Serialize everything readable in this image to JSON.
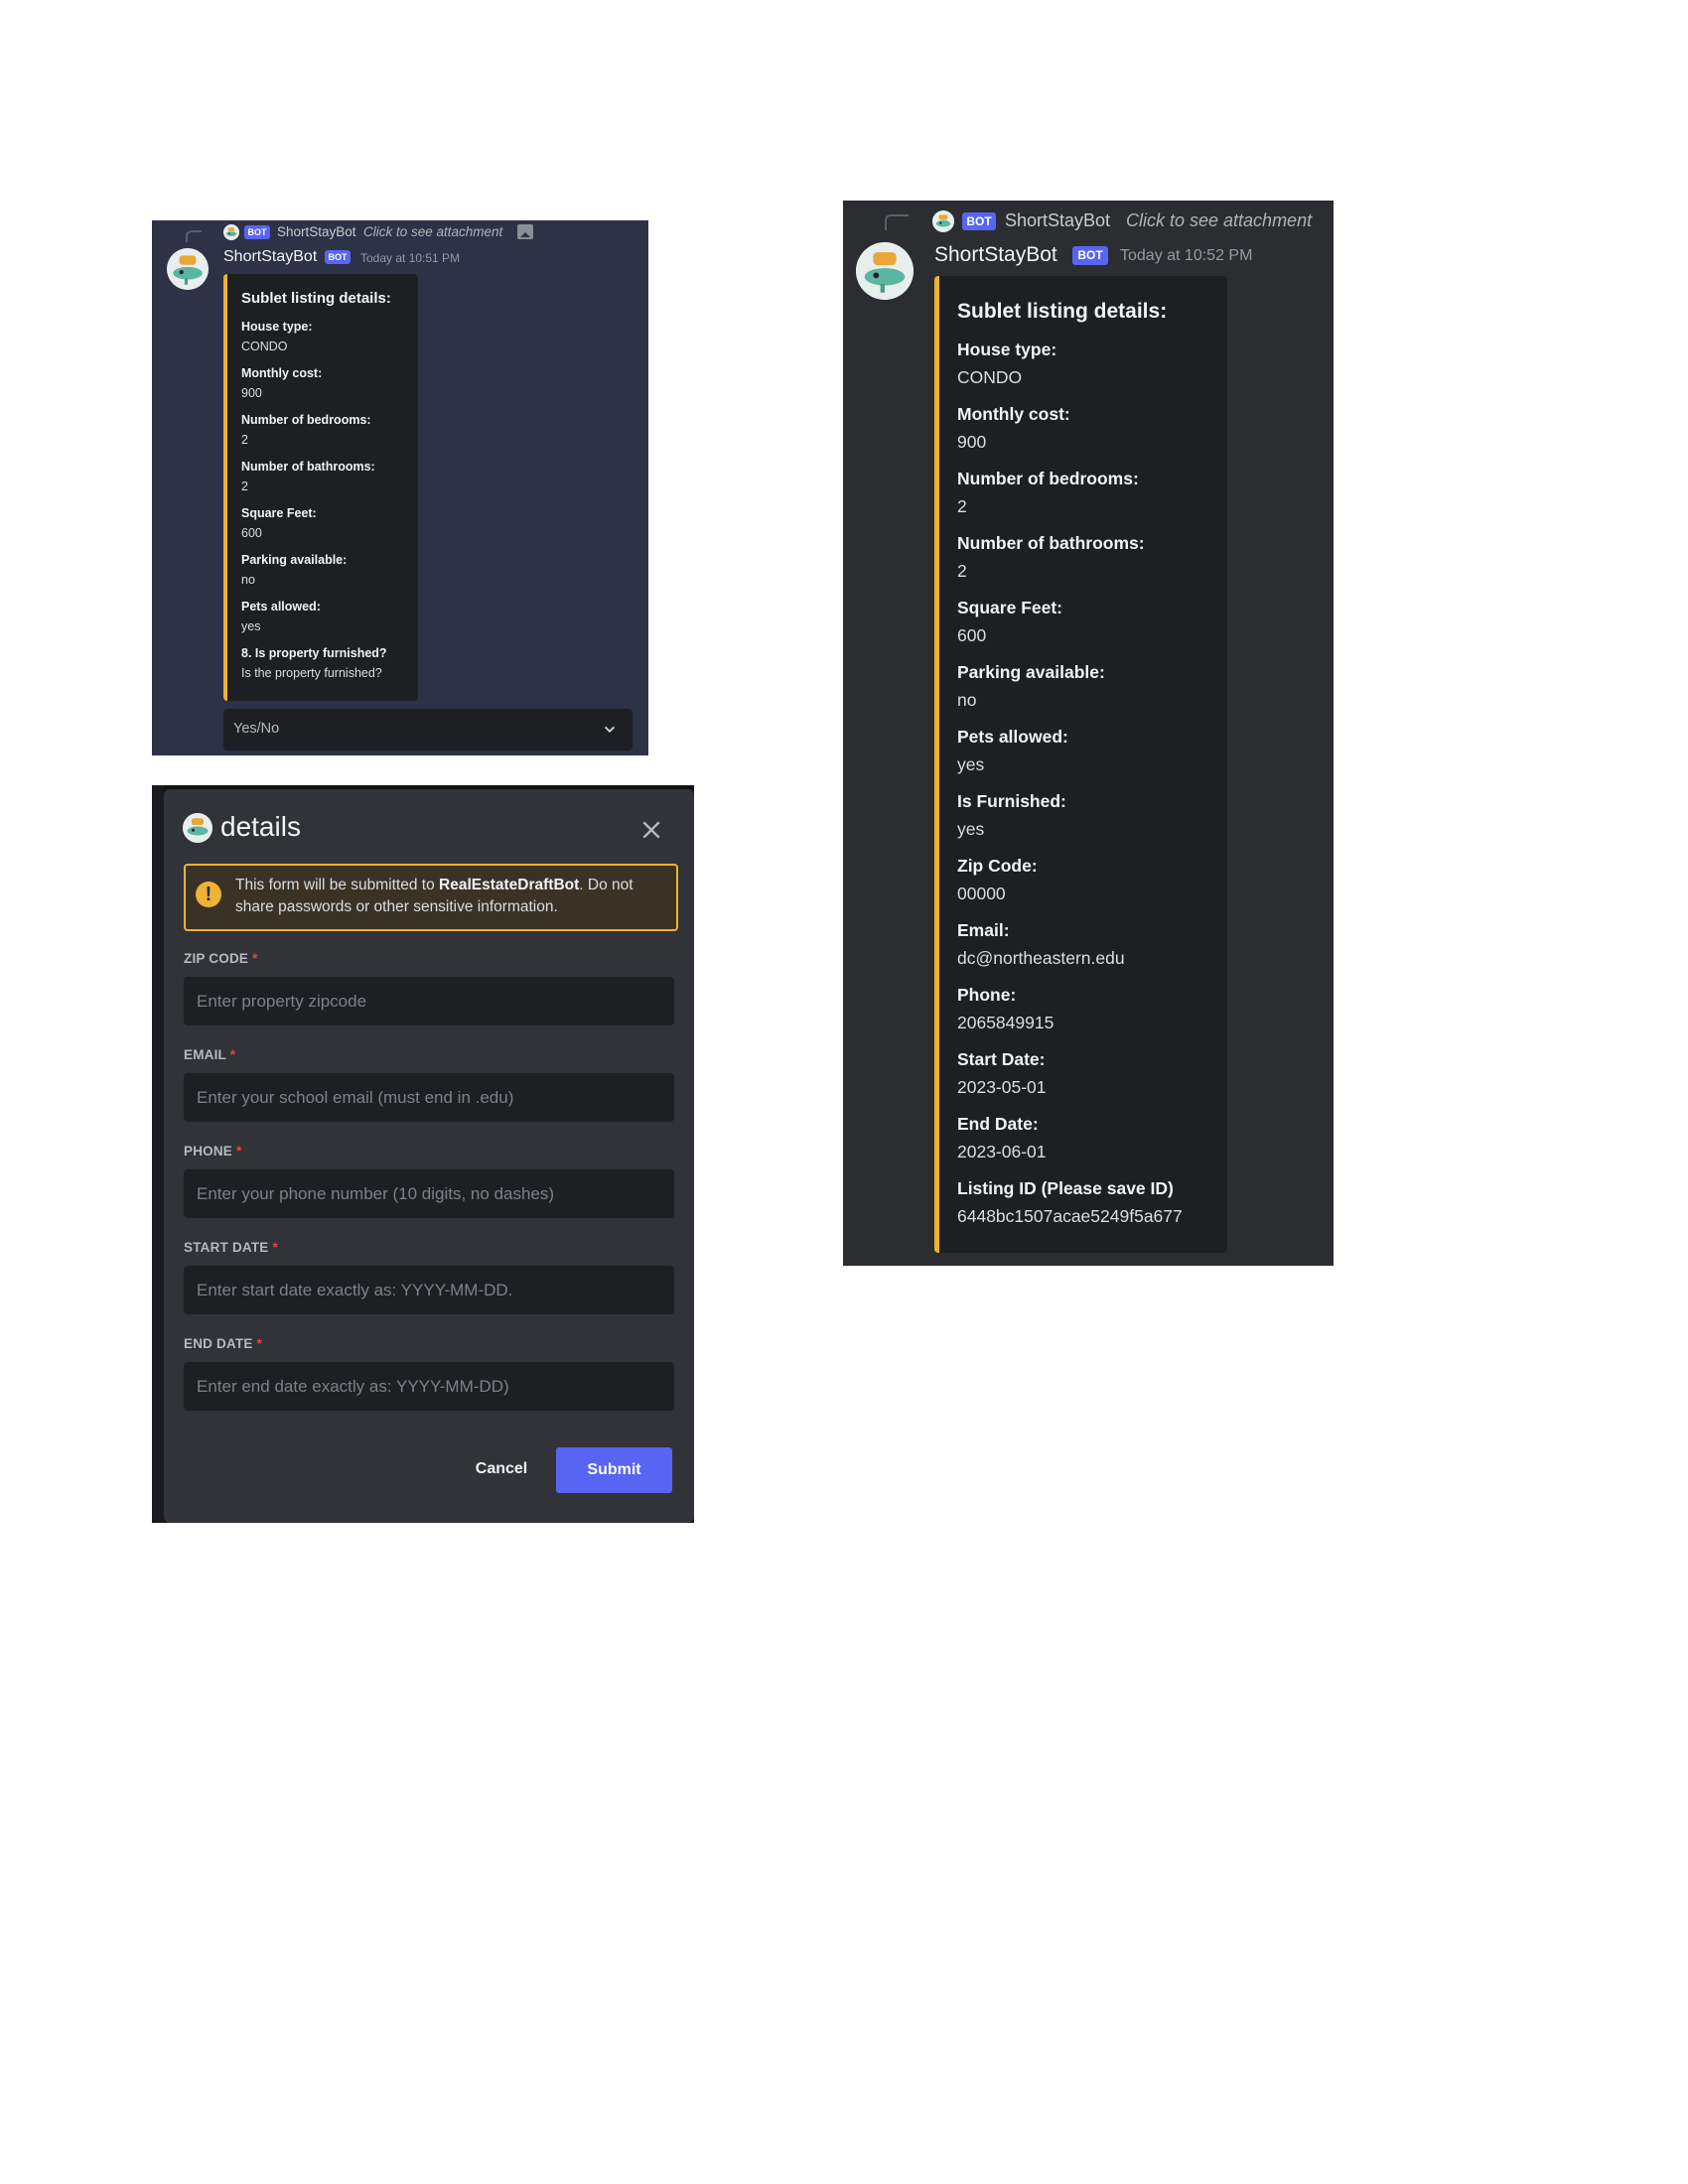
{
  "panel_small": {
    "reply": {
      "bot_tag": "BOT",
      "name": "ShortStayBot",
      "action": "Click to see attachment"
    },
    "author": "ShortStayBot",
    "bot_tag": "BOT",
    "timestamp": "Today at 10:51 PM",
    "embed": {
      "title": "Sublet listing details:",
      "fields": [
        {
          "name": "House type:",
          "value": "CONDO"
        },
        {
          "name": "Monthly cost:",
          "value": "900"
        },
        {
          "name": "Number of bedrooms:",
          "value": "2"
        },
        {
          "name": "Number of bathrooms:",
          "value": "2"
        },
        {
          "name": "Square Feet:",
          "value": "600"
        },
        {
          "name": "Parking available:",
          "value": "no"
        },
        {
          "name": "Pets allowed:",
          "value": "yes"
        },
        {
          "name": "8. Is property furnished?",
          "value": "Is the property furnished?"
        }
      ]
    },
    "dropdown": {
      "placeholder": "Yes/No"
    }
  },
  "modal": {
    "title": "details",
    "warning_prefix": "This form will be submitted to ",
    "warning_bot": "RealEstateDraftBot",
    "warning_suffix": ". Do not share passwords or other sensitive information.",
    "fields": [
      {
        "label": "ZIP CODE",
        "required": "*",
        "placeholder": "Enter property zipcode"
      },
      {
        "label": "EMAIL",
        "required": "*",
        "placeholder": "Enter your school email (must end in .edu)"
      },
      {
        "label": "PHONE",
        "required": "*",
        "placeholder": "Enter your phone number (10 digits, no dashes)"
      },
      {
        "label": "START DATE",
        "required": "*",
        "placeholder": "Enter start date exactly as: YYYY-MM-DD."
      },
      {
        "label": "END DATE",
        "required": "*",
        "placeholder": "Enter end date exactly as: YYYY-MM-DD)"
      }
    ],
    "cancel_label": "Cancel",
    "submit_label": "Submit"
  },
  "panel_large": {
    "reply": {
      "bot_tag": "BOT",
      "name": "ShortStayBot",
      "action": "Click to see attachment"
    },
    "author": "ShortStayBot",
    "bot_tag": "BOT",
    "timestamp": "Today at 10:52 PM",
    "embed": {
      "title": "Sublet listing details:",
      "fields": [
        {
          "name": "House type:",
          "value": "CONDO"
        },
        {
          "name": "Monthly cost:",
          "value": "900"
        },
        {
          "name": "Number of bedrooms:",
          "value": "2"
        },
        {
          "name": "Number of bathrooms:",
          "value": "2"
        },
        {
          "name": "Square Feet:",
          "value": "600"
        },
        {
          "name": "Parking available:",
          "value": "no"
        },
        {
          "name": "Pets allowed:",
          "value": "yes"
        },
        {
          "name": "Is Furnished:",
          "value": "yes"
        },
        {
          "name": "Zip Code:",
          "value": "00000"
        },
        {
          "name": "Email:",
          "value": "dc@northeastern.edu"
        },
        {
          "name": "Phone:",
          "value": "2065849915"
        },
        {
          "name": "Start Date:",
          "value": "2023-05-01"
        },
        {
          "name": "End Date:",
          "value": "2023-06-01"
        },
        {
          "name": "Listing ID (Please save ID)",
          "value": "6448bc1507acae5249f5a677"
        }
      ]
    }
  },
  "colors": {
    "accent": "#f0b232",
    "bot_tag": "#5865f2",
    "submit": "#5865f2",
    "required": "#f23f43"
  }
}
